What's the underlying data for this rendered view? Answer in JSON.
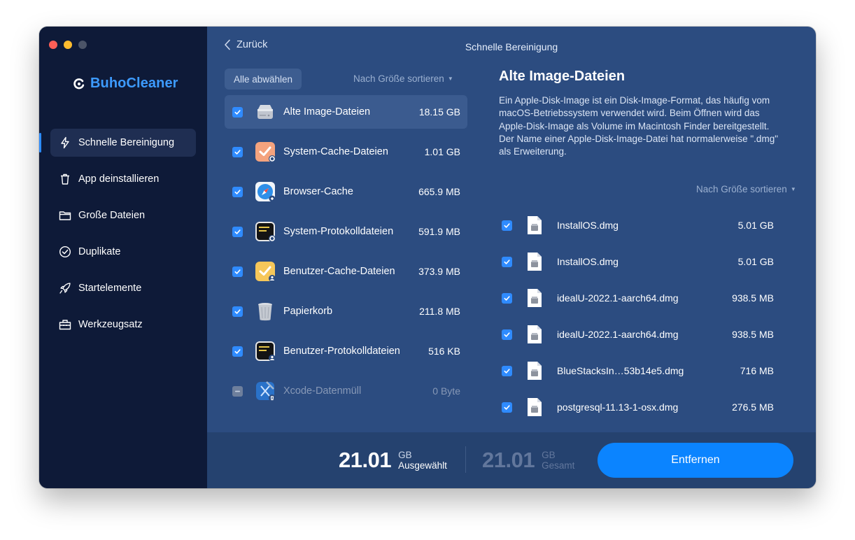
{
  "app": {
    "name": "BuhoCleaner"
  },
  "sidebar": {
    "items": [
      {
        "label": "Schnelle Bereinigung",
        "icon": "bolt-icon",
        "active": true
      },
      {
        "label": "App deinstallieren",
        "icon": "trash-icon",
        "active": false
      },
      {
        "label": "Große Dateien",
        "icon": "folder-icon",
        "active": false
      },
      {
        "label": "Duplikate",
        "icon": "check-circle-icon",
        "active": false
      },
      {
        "label": "Startelemente",
        "icon": "rocket-icon",
        "active": false
      },
      {
        "label": "Werkzeugsatz",
        "icon": "toolbox-icon",
        "active": false
      }
    ]
  },
  "header": {
    "back_label": "Zurück",
    "title": "Schnelle Bereinigung"
  },
  "list": {
    "deselect_label": "Alle abwählen",
    "sort_label": "Nach Größe sortieren",
    "categories": [
      {
        "name": "Alte Image-Dateien",
        "size": "18.15 GB",
        "checked": true,
        "icon": "disk-image-icon"
      },
      {
        "name": "System-Cache-Dateien",
        "size": "1.01 GB",
        "checked": true,
        "icon": "system-cache-icon"
      },
      {
        "name": "Browser-Cache",
        "size": "665.9 MB",
        "checked": true,
        "icon": "safari-icon"
      },
      {
        "name": "System-Protokolldateien",
        "size": "591.9 MB",
        "checked": true,
        "icon": "system-log-icon"
      },
      {
        "name": "Benutzer-Cache-Dateien",
        "size": "373.9 MB",
        "checked": true,
        "icon": "user-cache-icon"
      },
      {
        "name": "Papierkorb",
        "size": "211.8 MB",
        "checked": true,
        "icon": "trash-bin-icon"
      },
      {
        "name": "Benutzer-Protokolldateien",
        "size": "516 KB",
        "checked": true,
        "icon": "user-log-icon"
      },
      {
        "name": "Xcode-Datenmüll",
        "size": "0 Byte",
        "checked": false,
        "icon": "xcode-icon"
      }
    ]
  },
  "detail": {
    "title": "Alte Image-Dateien",
    "description": "Ein Apple-Disk-Image ist ein Disk-Image-Format, das häufig vom macOS-Betriebssystem verwendet wird. Beim Öffnen wird das Apple-Disk-Image als Volume im Macintosh Finder bereitgestellt. Der Name einer Apple-Disk-Image-Datei hat normalerweise \".dmg\" als Erweiterung.",
    "sort_label": "Nach Größe sortieren",
    "files": [
      {
        "name": "InstallOS.dmg",
        "size": "5.01 GB"
      },
      {
        "name": "InstallOS.dmg",
        "size": "5.01 GB"
      },
      {
        "name": "idealU-2022.1-aarch64.dmg",
        "size": "938.5 MB"
      },
      {
        "name": "idealU-2022.1-aarch64.dmg",
        "size": "938.5 MB"
      },
      {
        "name": "BlueStacksIn…53b14e5.dmg",
        "size": "716 MB"
      },
      {
        "name": "postgresql-11.13-1-osx.dmg",
        "size": "276.5 MB"
      }
    ]
  },
  "footer": {
    "selected": {
      "value": "21.01",
      "unit": "GB",
      "label": "Ausgewählt"
    },
    "total": {
      "value": "21.01",
      "unit": "GB",
      "label": "Gesamt"
    },
    "remove_label": "Entfernen"
  },
  "colors": {
    "accent": "#0b84ff",
    "brand": "#3d9bff",
    "sidebar": "#0e1a38",
    "panel": "#2c4c80"
  }
}
